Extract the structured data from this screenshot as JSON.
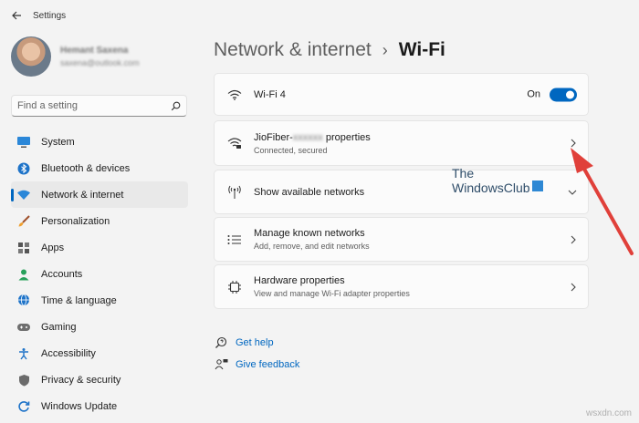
{
  "app": {
    "title": "Settings"
  },
  "profile": {
    "name": "Hemant Saxena",
    "email": "saxena@outlook.com"
  },
  "search": {
    "placeholder": "Find a setting"
  },
  "sidebar": {
    "items": [
      {
        "label": "System",
        "icon": "monitor-icon"
      },
      {
        "label": "Bluetooth & devices",
        "icon": "bluetooth-icon"
      },
      {
        "label": "Network & internet",
        "icon": "wifi-icon",
        "selected": true
      },
      {
        "label": "Personalization",
        "icon": "brush-icon"
      },
      {
        "label": "Apps",
        "icon": "apps-icon"
      },
      {
        "label": "Accounts",
        "icon": "person-icon"
      },
      {
        "label": "Time & language",
        "icon": "globe-clock-icon"
      },
      {
        "label": "Gaming",
        "icon": "gamepad-icon"
      },
      {
        "label": "Accessibility",
        "icon": "accessibility-icon"
      },
      {
        "label": "Privacy & security",
        "icon": "shield-icon"
      },
      {
        "label": "Windows Update",
        "icon": "update-icon"
      }
    ]
  },
  "header": {
    "parent": "Network & internet",
    "separator": "›",
    "current": "Wi-Fi"
  },
  "cards": {
    "wifi": {
      "title": "Wi-Fi 4",
      "toggle_label": "On",
      "toggle_on": true
    },
    "network": {
      "title_prefix": "JioFiber-",
      "title_hidden": "xxxxxx",
      "title_suffix": " properties",
      "subtitle": "Connected, secured"
    },
    "available": {
      "title": "Show available networks"
    },
    "known": {
      "title": "Manage known networks",
      "subtitle": "Add, remove, and edit networks"
    },
    "hardware": {
      "title": "Hardware properties",
      "subtitle": "View and manage Wi-Fi adapter properties"
    }
  },
  "links": {
    "help": "Get help",
    "feedback": "Give feedback"
  },
  "watermark": {
    "line1": "The",
    "line2": "WindowsClub",
    "site": "wsxdn.com"
  },
  "colors": {
    "accent": "#0067c0",
    "background": "#f3f3f3",
    "card": "#fbfbfb",
    "arrow": "#e0403a"
  }
}
